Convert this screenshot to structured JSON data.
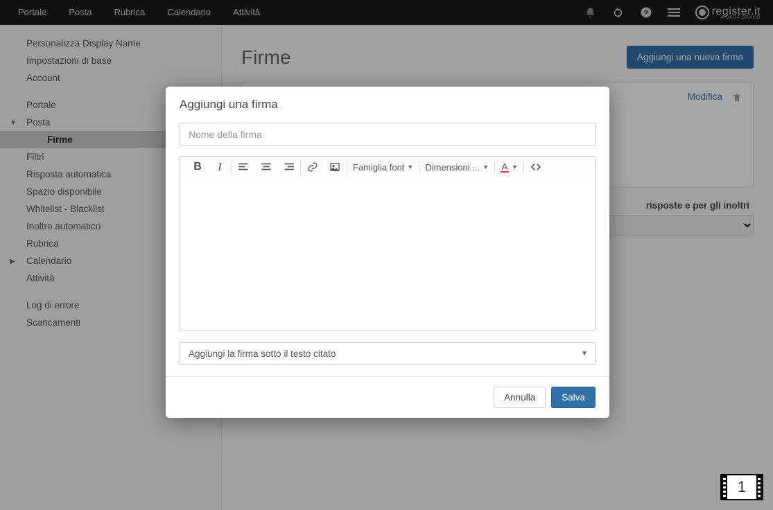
{
  "nav": {
    "items": [
      "Portale",
      "Posta",
      "Rubrica",
      "Calendario",
      "Attività"
    ],
    "logo": "register.it",
    "logo_sub": "A DADA BRAND"
  },
  "sidebar": {
    "items": [
      {
        "label": "Personalizza Display Name",
        "type": "item"
      },
      {
        "label": "Impostazioni di base",
        "type": "item"
      },
      {
        "label": "Account",
        "type": "item"
      },
      {
        "label": "Portale",
        "type": "item",
        "space_before": true
      },
      {
        "label": "Posta",
        "type": "group",
        "expanded": true
      },
      {
        "label": "Firme",
        "type": "sub",
        "active": true
      },
      {
        "label": "Filtri",
        "type": "sub"
      },
      {
        "label": "Risposta automatica",
        "type": "sub"
      },
      {
        "label": "Spazio disponibile",
        "type": "sub"
      },
      {
        "label": "Whitelist - Blacklist",
        "type": "sub"
      },
      {
        "label": "Inoltro automatico",
        "type": "sub"
      },
      {
        "label": "Rubrica",
        "type": "item"
      },
      {
        "label": "Calendario",
        "type": "group",
        "collapsed": true
      },
      {
        "label": "Attività",
        "type": "item"
      },
      {
        "label": "Log di errore",
        "type": "item",
        "space_before": true
      },
      {
        "label": "Scaricamenti",
        "type": "item"
      }
    ]
  },
  "main": {
    "title": "Firme",
    "add_btn": "Aggiungi una nuova firma",
    "modify": "Modifica",
    "default_label": "risposte e per gli inoltri"
  },
  "modal": {
    "title": "Aggiungi una firma",
    "name_placeholder": "Nome della firma",
    "toolbar": {
      "font_family": "Famiglia font",
      "font_size": "Dimensioni ..."
    },
    "position_select": "Aggiungi la firma sotto il testo citato",
    "cancel": "Annulla",
    "save": "Salva"
  },
  "page_indicator": "1"
}
